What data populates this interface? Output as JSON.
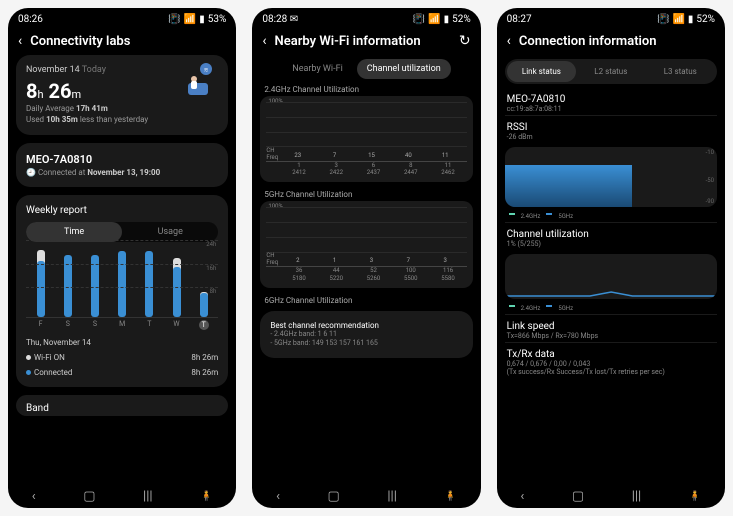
{
  "screen1": {
    "time": "08:26",
    "battery": "53%",
    "title": "Connectivity labs",
    "date_prefix": "November 14",
    "date_suffix": "Today",
    "usage_h": "8",
    "usage_h_unit": "h",
    "usage_m": "26",
    "usage_m_unit": "m",
    "avg_label": "Daily Average",
    "avg_value": "17h 41m",
    "diff_prefix": "Used",
    "diff_value": "10h 35m",
    "diff_suffix": "less than yesterday",
    "ssid": "MEO-7A0810",
    "connected_prefix": "Connected at",
    "connected_at": "November 13, 19:00",
    "weekly_title": "Weekly report",
    "seg_time": "Time",
    "seg_usage": "Usage",
    "grid_24": "24h",
    "grid_16": "16h",
    "grid_8": "8h",
    "days": [
      "F",
      "S",
      "S",
      "M",
      "T",
      "W",
      "T"
    ],
    "legend_date": "Thu, November 14",
    "legend_wifi": "Wi-Fi ON",
    "legend_conn": "Connected",
    "legend_wifi_val": "8h 26m",
    "legend_conn_val": "8h 26m",
    "band_label": "Band"
  },
  "screen2": {
    "time": "08:28",
    "battery": "52%",
    "title": "Nearby Wi-Fi information",
    "tab_nearby": "Nearby Wi-Fi",
    "tab_channel": "Channel utilization",
    "sec24_title": "2.4GHz Channel Utilization",
    "sec5_title": "5GHz Channel Utilization",
    "sec6_title": "6GHz Channel Utilization",
    "y100": "100%",
    "axis_ch": "CH",
    "axis_freq": "Freq",
    "rec_title": "Best channel recommendation",
    "rec_24": "- 2.4GHz band: 1 6 11",
    "rec_5": "- 5GHz band: 149 153 157 161 165"
  },
  "screen3": {
    "time": "08:27",
    "battery": "52%",
    "title": "Connection information",
    "pill_link": "Link status",
    "pill_l2": "L2 status",
    "pill_l3": "L3 status",
    "ssid": "MEO-7A0810",
    "mac": "cc:19:a8:7a:08:11",
    "rssi_title": "RSSI",
    "rssi_val": "-26 dBm",
    "legend_24": "2.4GHz",
    "legend_5": "5GHz",
    "chutil_title": "Channel utilization",
    "chutil_val": "1% (5/255)",
    "link_title": "Link speed",
    "link_val": "Tx=866 Mbps / Rx=780 Mbps",
    "txrx_title": "Tx/Rx data",
    "txrx_val1": "0,674 / 0,676 / 0,00 / 0,043",
    "txrx_val2": "(Tx success/Rx Success/Tx lost/Tx retries per sec)"
  },
  "chart_data": [
    {
      "type": "bar",
      "title": "Weekly report (Time)",
      "categories": [
        "F",
        "S",
        "S",
        "M",
        "T",
        "W",
        "T"
      ],
      "series": [
        {
          "name": "Wi-Fi ON",
          "values": [
            24,
            22,
            22,
            24,
            24,
            20,
            8.43
          ]
        },
        {
          "name": "Connected",
          "values": [
            20,
            22,
            22,
            24,
            24,
            18,
            8.43
          ]
        }
      ],
      "ylabel": "hours",
      "ylim": [
        0,
        24
      ]
    },
    {
      "type": "bar",
      "title": "2.4GHz Channel Utilization",
      "x_ch": [
        1,
        3,
        6,
        8,
        11
      ],
      "x_freq": [
        2412,
        2422,
        2437,
        2447,
        2462
      ],
      "values": [
        23,
        7,
        15,
        40,
        11
      ],
      "ylabel": "%",
      "ylim": [
        0,
        100
      ]
    },
    {
      "type": "bar",
      "title": "5GHz Channel Utilization",
      "x_ch": [
        36,
        44,
        52,
        100,
        116
      ],
      "x_freq": [
        5180,
        5220,
        5260,
        5500,
        5580
      ],
      "values": [
        2,
        1,
        3,
        7,
        3
      ],
      "ylabel": "%",
      "ylim": [
        0,
        100
      ]
    },
    {
      "type": "line",
      "title": "RSSI",
      "ylabel": "dBm",
      "ylim": [
        -90,
        -10
      ],
      "current": -26
    },
    {
      "type": "line",
      "title": "Channel utilization",
      "ylabel": "%",
      "current": 1
    }
  ]
}
